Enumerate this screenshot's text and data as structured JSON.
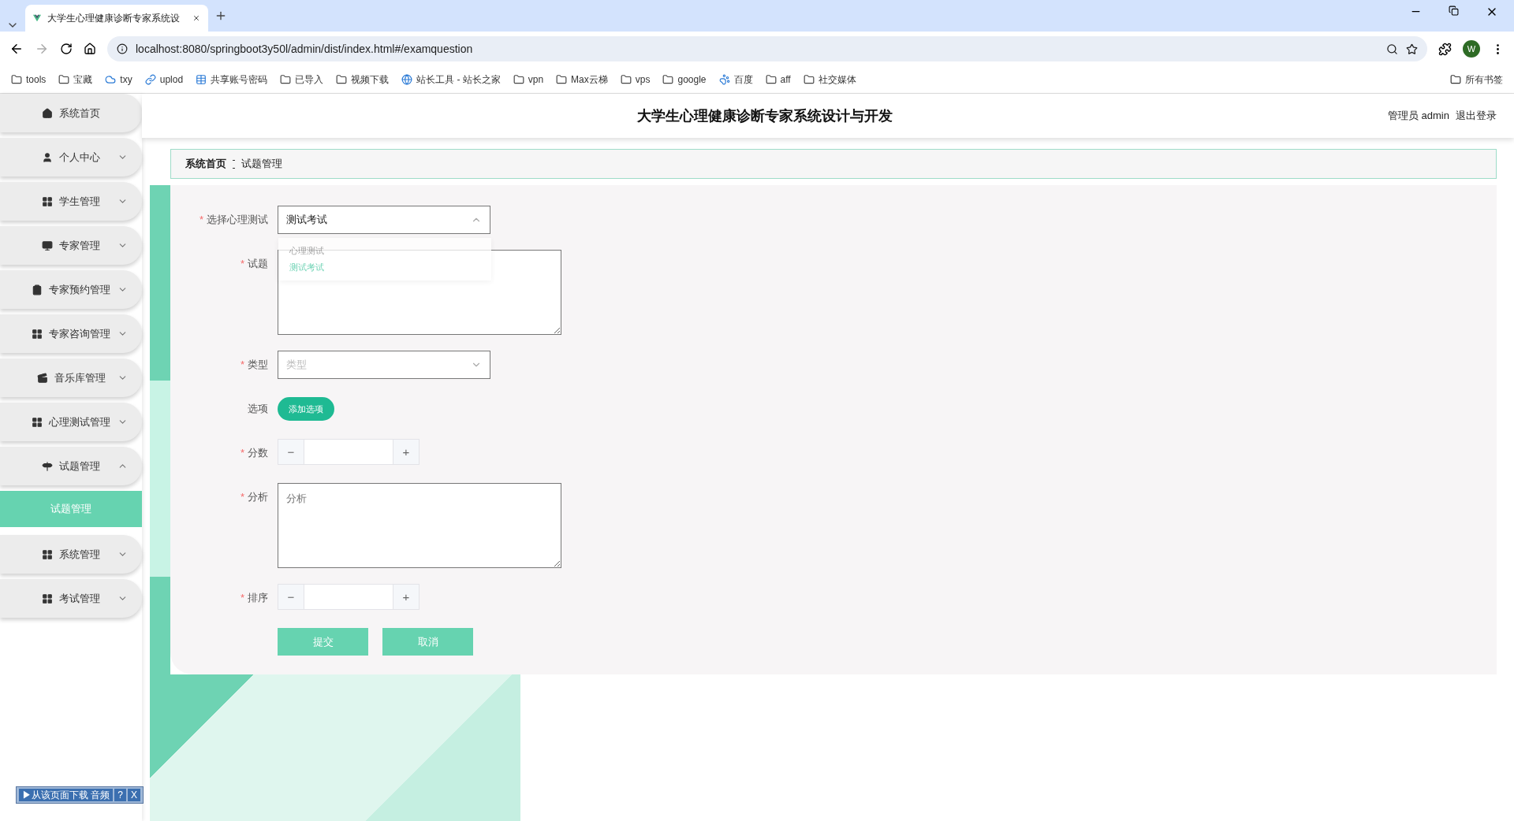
{
  "browser": {
    "tab_title": "大学生心理健康诊断专家系统设",
    "url": "localhost:8080/springboot3y50l/admin/dist/index.html#/examquestion",
    "avatar": "W",
    "bookmarks": [
      {
        "label": "tools",
        "kind": "folder"
      },
      {
        "label": "宝藏",
        "kind": "folder"
      },
      {
        "label": "txy",
        "kind": "cloud"
      },
      {
        "label": "uplod",
        "kind": "link"
      },
      {
        "label": "共享账号密码",
        "kind": "sheet"
      },
      {
        "label": "已导入",
        "kind": "folder"
      },
      {
        "label": "视频下载",
        "kind": "folder"
      },
      {
        "label": "站长工具 - 站长之家",
        "kind": "site"
      },
      {
        "label": "vpn",
        "kind": "folder"
      },
      {
        "label": "Max云梯",
        "kind": "folder"
      },
      {
        "label": "vps",
        "kind": "folder"
      },
      {
        "label": "google",
        "kind": "folder"
      },
      {
        "label": "百度",
        "kind": "paw"
      },
      {
        "label": "aff",
        "kind": "folder"
      },
      {
        "label": "社交媒体",
        "kind": "folder"
      }
    ],
    "all_bookmarks": "所有书签"
  },
  "sidebar": {
    "items": [
      {
        "label": "系统首页"
      },
      {
        "label": "个人中心",
        "expanded": false
      },
      {
        "label": "学生管理",
        "expanded": false
      },
      {
        "label": "专家管理",
        "expanded": false
      },
      {
        "label": "专家预约管理",
        "expanded": false
      },
      {
        "label": "专家咨询管理",
        "expanded": false
      },
      {
        "label": "音乐库管理",
        "expanded": false
      },
      {
        "label": "心理测试管理",
        "expanded": false
      },
      {
        "label": "试题管理",
        "expanded": true,
        "children": [
          {
            "label": "试题管理",
            "selected": true
          }
        ]
      },
      {
        "label": "系统管理",
        "expanded": false
      },
      {
        "label": "考试管理",
        "expanded": false
      }
    ]
  },
  "header": {
    "title": "大学生心理健康诊断专家系统设计与开发",
    "user": "管理员 admin",
    "logout": "退出登录"
  },
  "breadcrumb": [
    "系统首页",
    "试题管理"
  ],
  "form": {
    "fields": [
      {
        "kind": "select",
        "label": "选择心理测试",
        "required_mark": "*",
        "value": "测试考试",
        "open": true,
        "options": [
          {
            "label": "心理测试",
            "selected": false
          },
          {
            "label": "测试考试",
            "selected": true
          }
        ]
      },
      {
        "kind": "textarea",
        "label": "试题",
        "required_mark": "*"
      },
      {
        "kind": "select",
        "label": "类型",
        "required_mark": "*",
        "placeholder": "类型",
        "open": false
      },
      {
        "kind": "action",
        "label": "选项",
        "button": "添加选项"
      },
      {
        "kind": "number",
        "label": "分数",
        "required_mark": "*",
        "minus": "−",
        "plus": "+"
      },
      {
        "kind": "textarea",
        "label": "分析",
        "required_mark": "*",
        "placeholder": "分析"
      },
      {
        "kind": "number",
        "label": "排序",
        "required_mark": "*",
        "minus": "−",
        "plus": "+"
      }
    ],
    "buttons": [
      "提交",
      "取消"
    ]
  },
  "download_bar": {
    "label": "▶从该页面下载 音频",
    "help": "?",
    "close": "X"
  }
}
